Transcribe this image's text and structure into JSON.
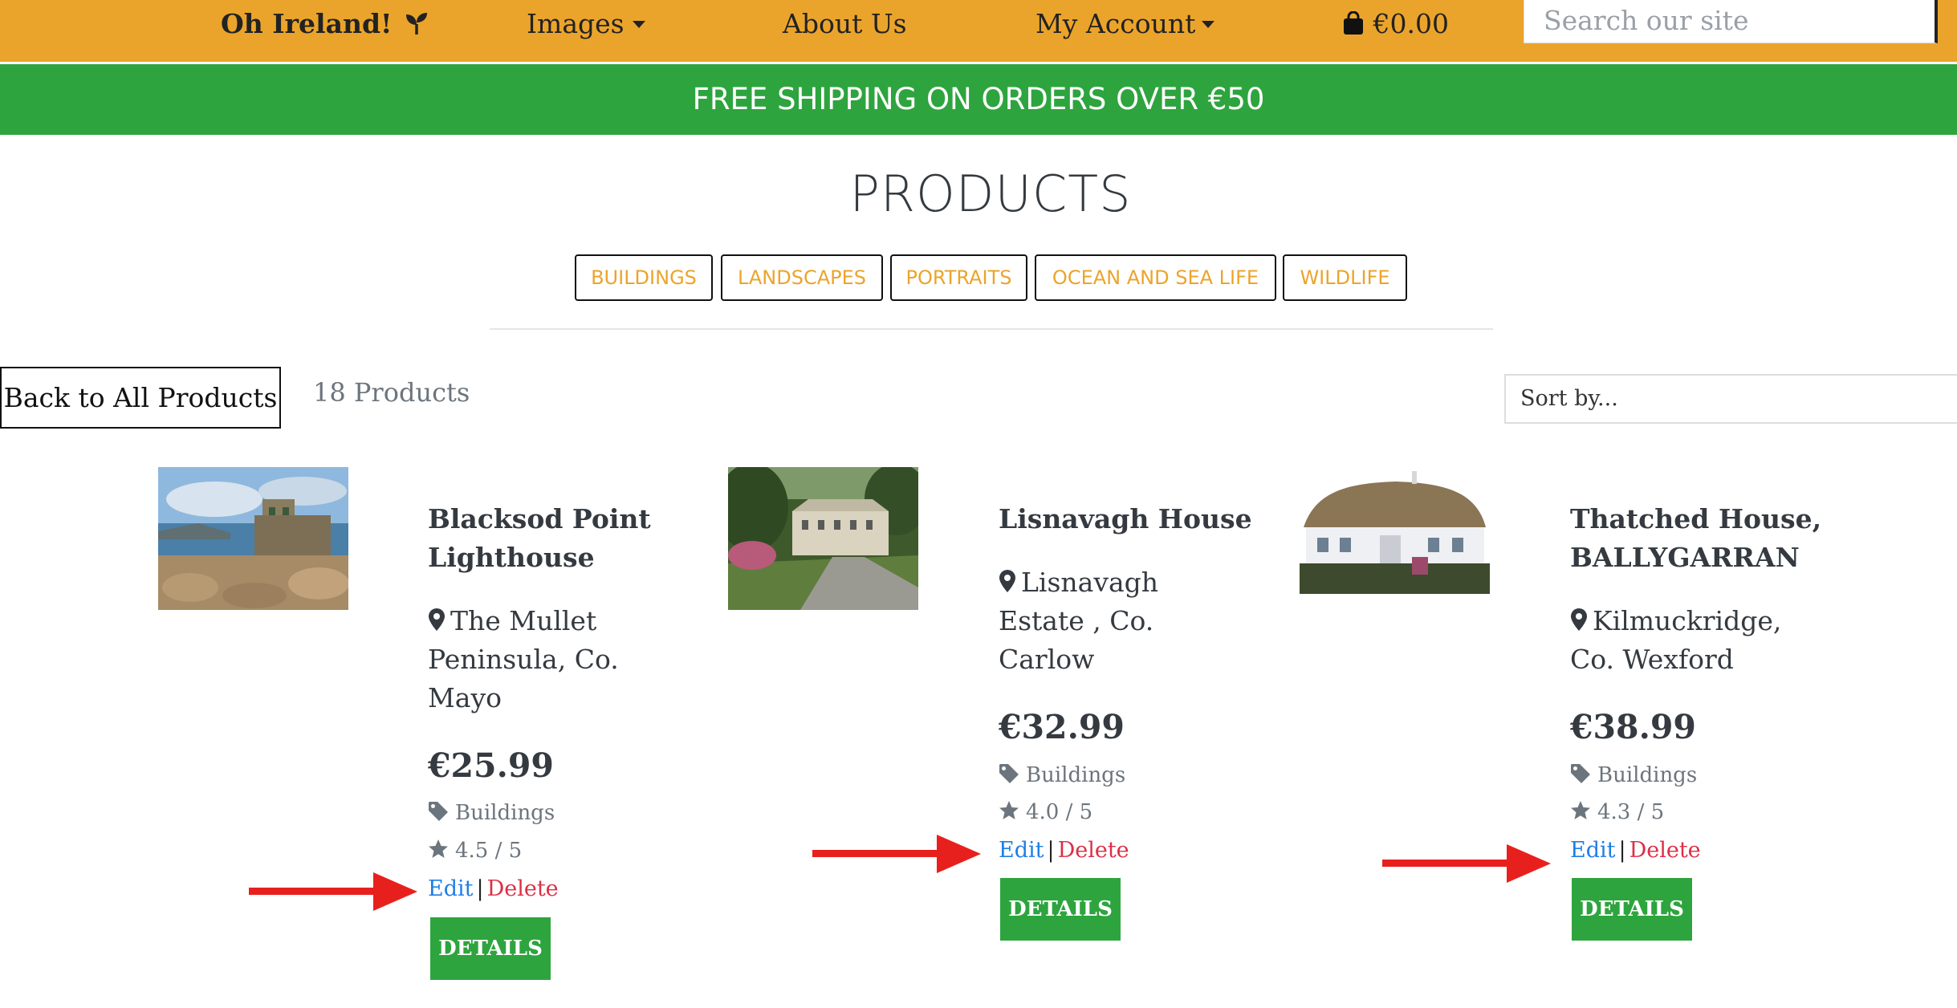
{
  "nav": {
    "brand": "Oh Ireland!",
    "images": "Images",
    "about": "About Us",
    "account": "My Account",
    "cart_total": "€0.00",
    "search_placeholder": "Search our site"
  },
  "promo": "FREE SHIPPING ON ORDERS OVER €50",
  "page_title": "PRODUCTS",
  "categories": [
    "BUILDINGS",
    "LANDSCAPES",
    "PORTRAITS",
    "OCEAN AND SEA LIFE",
    "WILDLIFE"
  ],
  "toolbar": {
    "back_label": "Back to All Products",
    "count": "18 Products",
    "sort_label": "Sort by..."
  },
  "products": [
    {
      "name_lines": [
        "Blacksod Point",
        "Lighthouse"
      ],
      "location_lines": [
        "The Mullet",
        "Peninsula, Co.",
        "Mayo"
      ],
      "price": "€25.99",
      "category": "Buildings",
      "rating": "4.5 / 5",
      "edit": "Edit",
      "sep": "|",
      "delete": "Delete",
      "details": "DETAILS"
    },
    {
      "name_lines": [
        "Lisnavagh House"
      ],
      "location_lines": [
        "Lisnavagh",
        "Estate , Co.",
        "Carlow"
      ],
      "price": "€32.99",
      "category": "Buildings",
      "rating": "4.0 / 5",
      "edit": "Edit",
      "sep": "|",
      "delete": "Delete",
      "details": "DETAILS"
    },
    {
      "name_lines": [
        "Thatched House,",
        "BALLYGARRAN"
      ],
      "location_lines": [
        "Kilmuckridge,",
        "Co. Wexford"
      ],
      "price": "€38.99",
      "category": "Buildings",
      "rating": "4.3 / 5",
      "edit": "Edit",
      "sep": "|",
      "delete": "Delete",
      "details": "DETAILS"
    }
  ],
  "colors": {
    "nav_bg": "#eba42b",
    "promo_bg": "#2ea43e",
    "edit_link": "#1f7ee6",
    "delete_link": "#dc2f45",
    "details_bg": "#2ea43e",
    "annotation_arrow": "#e8201d"
  }
}
